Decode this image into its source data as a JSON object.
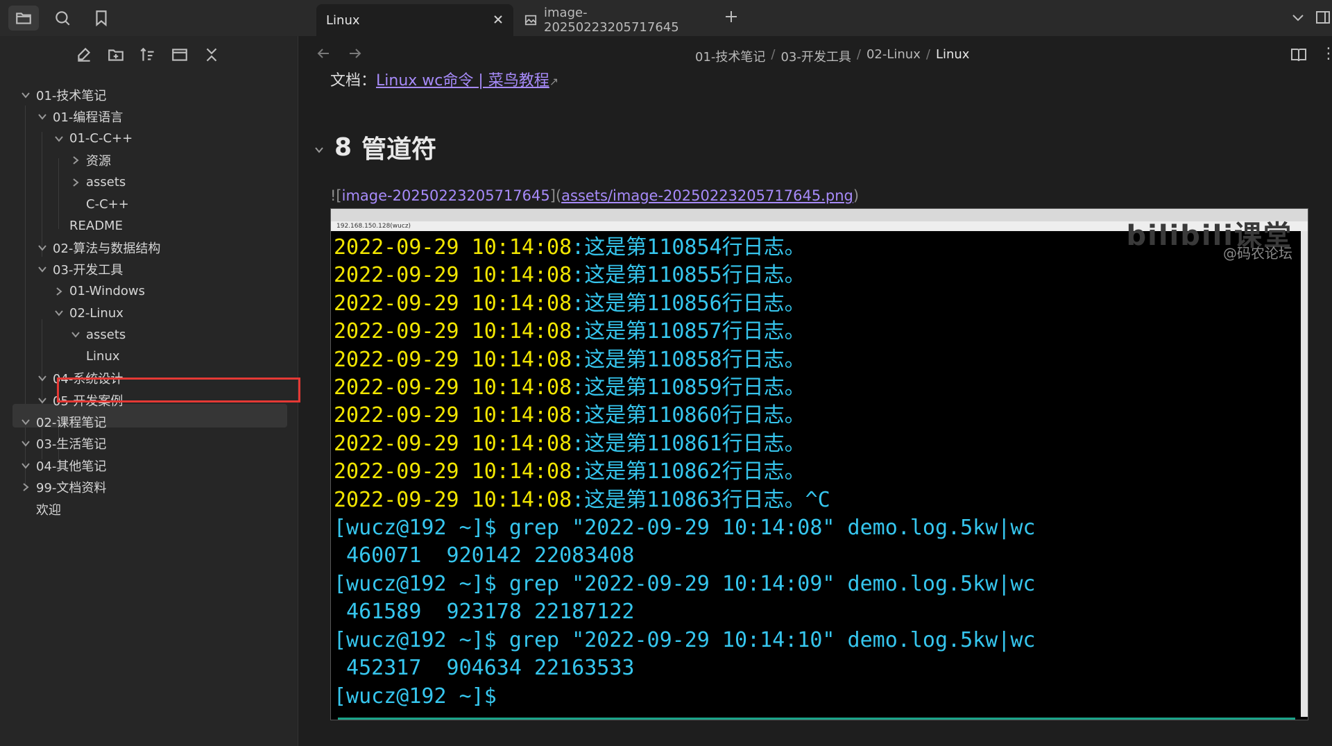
{
  "tabs": [
    {
      "label": "Linux",
      "active": true
    },
    {
      "label": "image-20250223205717645",
      "active": false
    }
  ],
  "sidebar": {
    "tree": [
      {
        "label": "01-技术笔记",
        "depth": 0,
        "arrow": "down"
      },
      {
        "label": "01-编程语言",
        "depth": 1,
        "arrow": "down"
      },
      {
        "label": "01-C-C++",
        "depth": 2,
        "arrow": "down"
      },
      {
        "label": "资源",
        "depth": 3,
        "arrow": "right"
      },
      {
        "label": "assets",
        "depth": 3,
        "arrow": "right"
      },
      {
        "label": "C-C++",
        "depth": 3,
        "arrow": "none"
      },
      {
        "label": "README",
        "depth": 2,
        "arrow": "none"
      },
      {
        "label": "02-算法与数据结构",
        "depth": 1,
        "arrow": "down"
      },
      {
        "label": "03-开发工具",
        "depth": 1,
        "arrow": "down"
      },
      {
        "label": "01-Windows",
        "depth": 2,
        "arrow": "right"
      },
      {
        "label": "02-Linux",
        "depth": 2,
        "arrow": "down"
      },
      {
        "label": "assets",
        "depth": 3,
        "arrow": "down"
      },
      {
        "label": "Linux",
        "depth": 3,
        "arrow": "none"
      },
      {
        "label": "04-系统设计",
        "depth": 1,
        "arrow": "down"
      },
      {
        "label": "05-开发案例",
        "depth": 1,
        "arrow": "down"
      },
      {
        "label": "02-课程笔记",
        "depth": 0,
        "arrow": "down"
      },
      {
        "label": "03-生活笔记",
        "depth": 0,
        "arrow": "down"
      },
      {
        "label": "04-其他笔记",
        "depth": 0,
        "arrow": "down"
      },
      {
        "label": "99-文档资料",
        "depth": 0,
        "arrow": "right"
      },
      {
        "label": "欢迎",
        "depth": 0,
        "arrow": "none"
      }
    ]
  },
  "breadcrumb": [
    "01-技术笔记",
    "03-开发工具",
    "02-Linux",
    "Linux"
  ],
  "content": {
    "partial_prefix": "文档：",
    "partial_link": "Linux wc命令 | 菜鸟教程",
    "heading_number": "8",
    "heading_text": "管道符",
    "image_prefix": "![",
    "image_alt": "image-20250223205717645",
    "image_mid": "](",
    "image_path": "assets/image-20250223205717645.png",
    "image_suffix": ")"
  },
  "terminal": {
    "address": "192.168.150.128(wucz)",
    "watermark_logo": "bilibili课堂",
    "watermark": "@码农论坛",
    "log_lines": [
      {
        "ts": "2022-09-29 10:14:08",
        "msg": ":这是第110854行日志。"
      },
      {
        "ts": "2022-09-29 10:14:08",
        "msg": ":这是第110855行日志。"
      },
      {
        "ts": "2022-09-29 10:14:08",
        "msg": ":这是第110856行日志。"
      },
      {
        "ts": "2022-09-29 10:14:08",
        "msg": ":这是第110857行日志。"
      },
      {
        "ts": "2022-09-29 10:14:08",
        "msg": ":这是第110858行日志。"
      },
      {
        "ts": "2022-09-29 10:14:08",
        "msg": ":这是第110859行日志。"
      },
      {
        "ts": "2022-09-29 10:14:08",
        "msg": ":这是第110860行日志。"
      },
      {
        "ts": "2022-09-29 10:14:08",
        "msg": ":这是第110861行日志。"
      },
      {
        "ts": "2022-09-29 10:14:08",
        "msg": ":这是第110862行日志。"
      },
      {
        "ts": "2022-09-29 10:14:08",
        "msg": ":这是第110863行日志。^C"
      }
    ],
    "cmd_lines": [
      "[wucz@192 ~]$ grep \"2022-09-29 10:14:08\" demo.log.5kw|wc",
      " 460071  920142 22083408",
      "[wucz@192 ~]$ grep \"2022-09-29 10:14:09\" demo.log.5kw|wc",
      " 461589  923178 22187122",
      "[wucz@192 ~]$ grep \"2022-09-29 10:14:10\" demo.log.5kw|wc",
      " 452317  904634 22163533",
      "[wucz@192 ~]$"
    ]
  },
  "colors": {
    "accent_link": "#a78bfa",
    "selection_box": "#e53935",
    "terminal_timestamp": "#f2e600",
    "terminal_text": "#36c6ee"
  }
}
